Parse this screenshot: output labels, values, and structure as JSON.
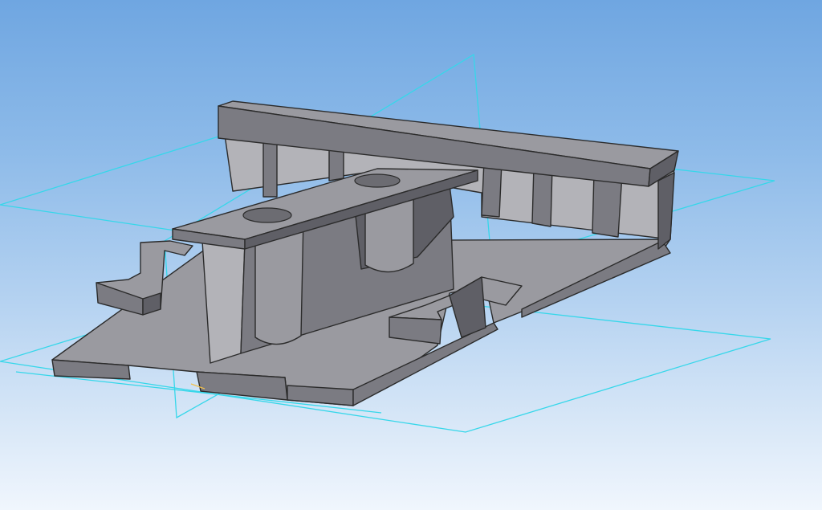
{
  "viewport": {
    "name": "3D model view",
    "background_top": "#6fa6e1",
    "background_bottom": "#f0f6fd",
    "model_color": "#9a9aa0",
    "plane_color": "#36d7ea"
  },
  "planes": [
    "front-plane",
    "top-plane",
    "right-plane"
  ]
}
